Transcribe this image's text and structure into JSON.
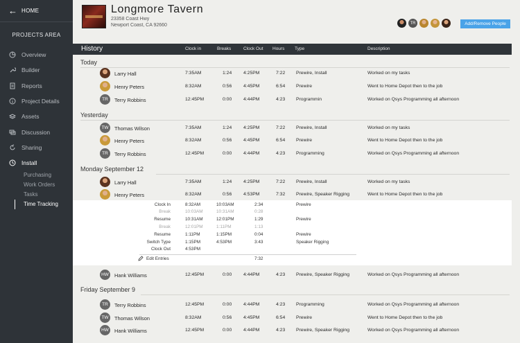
{
  "sidebar": {
    "home_label": "HOME",
    "section_label": "PROJECTS AREA",
    "items": [
      {
        "label": "Overview",
        "icon": "pie-chart-icon"
      },
      {
        "label": "Builder",
        "icon": "wrench-icon"
      },
      {
        "label": "Reports",
        "icon": "document-icon"
      },
      {
        "label": "Project Details",
        "icon": "info-icon"
      },
      {
        "label": "Assets",
        "icon": "layers-icon"
      },
      {
        "label": "Discussion",
        "icon": "chat-icon"
      },
      {
        "label": "Sharing",
        "icon": "share-icon"
      },
      {
        "label": "Install",
        "icon": "clock-icon"
      }
    ],
    "subitems": [
      "Purchasing",
      "Work Orders",
      "Tasks",
      "Time Tracking"
    ]
  },
  "header": {
    "venue_name": "Longmore Tavern",
    "address_line1": "23358 Coast Hwy",
    "address_line2": "Newport Coast, CA 92660",
    "people": [
      "",
      "TR",
      "",
      "",
      ""
    ],
    "add_people_label": "Add/Remove People"
  },
  "table": {
    "title": "History",
    "columns": {
      "clock_in": "Clock in",
      "breaks": "Breaks",
      "clock_out": "Clock Out",
      "hours": "Hours",
      "type": "Type",
      "description": "Description"
    }
  },
  "sections": [
    {
      "label": "Today",
      "rows": [
        {
          "initials": "",
          "name": "Larry Hall",
          "clock_in": "7:35AM",
          "breaks": "1:24",
          "clock_out": "4:25PM",
          "hours": "7:22",
          "type": "Prewire, Install",
          "description": "Worked on my tasks"
        },
        {
          "initials": "",
          "name": "Henry Peters",
          "clock_in": "8:32AM",
          "breaks": "0:56",
          "clock_out": "4:45PM",
          "hours": "6:54",
          "type": "Prewire",
          "description": "Went to Home Depot then to the job"
        },
        {
          "initials": "TR",
          "name": "Terry Robbins",
          "clock_in": "12:45PM",
          "breaks": "0:00",
          "clock_out": "4:44PM",
          "hours": "4:23",
          "type": "Programmin",
          "description": "Worked on Qsys Programming all afternoon"
        }
      ]
    },
    {
      "label": "Yesterday",
      "rows": [
        {
          "initials": "TW",
          "name": "Thomas Wilson",
          "clock_in": "7:35AM",
          "breaks": "1:24",
          "clock_out": "4:25PM",
          "hours": "7:22",
          "type": "Prewire, Install",
          "description": "Worked on my tasks"
        },
        {
          "initials": "",
          "name": "Henry Peters",
          "clock_in": "8:32AM",
          "breaks": "0:56",
          "clock_out": "4:45PM",
          "hours": "6:54",
          "type": "Prewire",
          "description": "Went to Home Depot then to the job"
        },
        {
          "initials": "TR",
          "name": "Terry Robbins",
          "clock_in": "12:45PM",
          "breaks": "0:00",
          "clock_out": "4:44PM",
          "hours": "4:23",
          "type": "Programming",
          "description": "Worked on Qsys Programming all afternoon"
        }
      ]
    },
    {
      "label": "Monday September 12",
      "rows": [
        {
          "initials": "",
          "name": "Larry Hall",
          "clock_in": "7:35AM",
          "breaks": "1:24",
          "clock_out": "4:25PM",
          "hours": "7:22",
          "type": "Prewire, Install",
          "description": "Worked on my tasks"
        },
        {
          "initials": "",
          "name": "Henry Peters",
          "clock_in": "8:32AM",
          "breaks": "0:56",
          "clock_out": "4:53PM",
          "hours": "7:32",
          "type": "Prewire, Speaker Rigging",
          "description": "Went to Home Depot then to the job"
        },
        {
          "initials": "HW",
          "name": "Hank Williams",
          "clock_in": "12:45PM",
          "breaks": "0:00",
          "clock_out": "4:44PM",
          "hours": "4:23",
          "type": "Prewire, Speaker Rigging",
          "description": "Worked on Qsys Programming all afternoon"
        }
      ]
    },
    {
      "label": "Friday September 9",
      "rows": [
        {
          "initials": "TR",
          "name": "Terry Robbins",
          "clock_in": "12:45PM",
          "breaks": "0:00",
          "clock_out": "4:44PM",
          "hours": "4:23",
          "type": "Programming",
          "description": "Worked on Qsys Programming all afternoon"
        },
        {
          "initials": "TW",
          "name": "Thomas Wilson",
          "clock_in": "8:32AM",
          "breaks": "0:56",
          "clock_out": "4:45PM",
          "hours": "6:54",
          "type": "Prewire",
          "description": "Went to Home Depot then to the job"
        },
        {
          "initials": "HW",
          "name": "Hank Williams",
          "clock_in": "12:45PM",
          "breaks": "0:00",
          "clock_out": "4:44PM",
          "hours": "4:23",
          "type": "Prewire, Speaker Rigging",
          "description": "Worked on Qsys Programming all afternoon"
        }
      ]
    }
  ],
  "detail": {
    "rows": [
      {
        "label": "Clock In",
        "t1": "8:32AM",
        "t2": "10:03AM",
        "dur": "2:34",
        "type": "Prewire",
        "muted": false
      },
      {
        "label": "Break",
        "t1": "10:03AM",
        "t2": "10:31AM",
        "dur": "0:28",
        "type": "",
        "muted": true
      },
      {
        "label": "Resume",
        "t1": "10:31AM",
        "t2": "12:01PM",
        "dur": "1:29",
        "type": "Prewire",
        "muted": false
      },
      {
        "label": "Break",
        "t1": "12:01PM",
        "t2": "1:11PM",
        "dur": "1:13",
        "type": "",
        "muted": true
      },
      {
        "label": "Resume",
        "t1": "1:11PM",
        "t2": "1:15PM",
        "dur": "0:04",
        "type": "Prewire",
        "muted": false
      },
      {
        "label": "Switch Type",
        "t1": "1:15PM",
        "t2": "4:53PM",
        "dur": "3:43",
        "type": "Speaker Rigging",
        "muted": false
      },
      {
        "label": "Clock Out",
        "t1": "4:53PM",
        "t2": "",
        "dur": "",
        "type": "",
        "muted": false
      }
    ],
    "edit_label": "Edit Entries",
    "total": "7:32"
  }
}
